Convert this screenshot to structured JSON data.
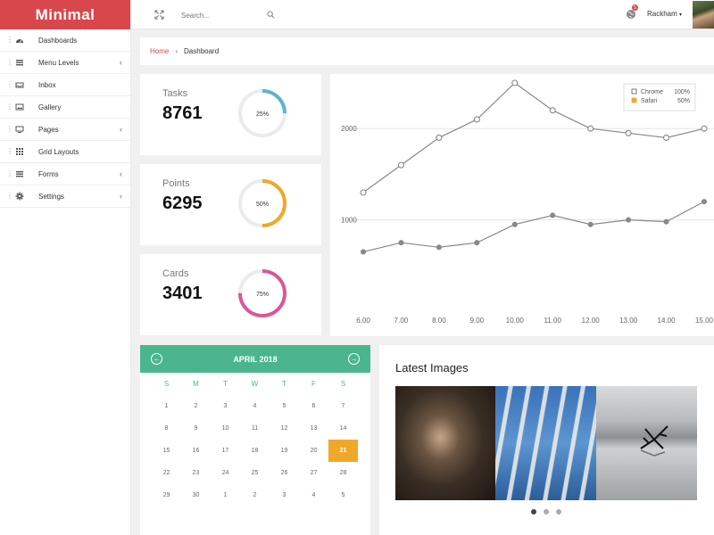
{
  "brand": "Minimal",
  "sidebar": {
    "items": [
      {
        "label": "Dashboards",
        "icon": "dashboard-icon",
        "has_children": false
      },
      {
        "label": "Menu Levels",
        "icon": "list-icon",
        "has_children": true
      },
      {
        "label": "Inbox",
        "icon": "inbox-icon",
        "has_children": false
      },
      {
        "label": "Gallery",
        "icon": "image-icon",
        "has_children": false
      },
      {
        "label": "Pages",
        "icon": "monitor-icon",
        "has_children": true
      },
      {
        "label": "Grid Layouts",
        "icon": "grid-icon",
        "has_children": false
      },
      {
        "label": "Forms",
        "icon": "form-icon",
        "has_children": true
      },
      {
        "label": "Settings",
        "icon": "gear-icon",
        "has_children": true
      }
    ],
    "chevron": "‹"
  },
  "topbar": {
    "search_placeholder": "Search...",
    "notification_count": "5",
    "username": "Rackham",
    "user_caret": "▾"
  },
  "breadcrumb": {
    "home": "Home",
    "separator": "›",
    "current": "Dashboard"
  },
  "stats": [
    {
      "label": "Tasks",
      "value": "8761",
      "percent": 25,
      "percent_label": "25%",
      "color": "#5bb5cf"
    },
    {
      "label": "Points",
      "value": "6295",
      "percent": 50,
      "percent_label": "50%",
      "color": "#f0a82a"
    },
    {
      "label": "Cards",
      "value": "3401",
      "percent": 75,
      "percent_label": "75%",
      "color": "#d95895"
    }
  ],
  "chart_data": {
    "type": "line",
    "x": [
      6.0,
      7.0,
      8.0,
      9.0,
      10.0,
      11.0,
      12.0,
      13.0,
      14.0,
      15.0
    ],
    "x_tick_labels": [
      "6.00",
      "7.00",
      "8.00",
      "9.00",
      "10.00",
      "11.00",
      "12.00",
      "13.00",
      "14.00",
      "15.00"
    ],
    "y_ticks": [
      1000,
      2000
    ],
    "y_tick_labels": [
      "1000",
      "2000"
    ],
    "ylim": [
      0,
      2500
    ],
    "series": [
      {
        "name": "Chrome",
        "legend_value": "100%",
        "marker": "hollow",
        "values": [
          1300,
          1600,
          1900,
          2100,
          2500,
          2200,
          2000,
          1950,
          1900,
          2000
        ]
      },
      {
        "name": "Safari",
        "legend_value": "50%",
        "marker": "filled",
        "values": [
          650,
          750,
          700,
          750,
          950,
          1050,
          950,
          1000,
          980,
          1200
        ]
      }
    ],
    "legend": {
      "position": "top-right",
      "colors": [
        "#ffffff",
        "#f0a82a"
      ]
    },
    "line_color": "#888888",
    "grid": true
  },
  "calendar": {
    "title": "APRIL 2018",
    "prev": "←",
    "next": "→",
    "weekdays": [
      "S",
      "M",
      "T",
      "W",
      "T",
      "F",
      "S"
    ],
    "weeks": [
      [
        "1",
        "2",
        "3",
        "4",
        "5",
        "6",
        "7"
      ],
      [
        "8",
        "9",
        "10",
        "11",
        "12",
        "13",
        "14"
      ],
      [
        "15",
        "16",
        "17",
        "18",
        "19",
        "20",
        "21"
      ],
      [
        "22",
        "23",
        "24",
        "25",
        "26",
        "27",
        "28"
      ],
      [
        "29",
        "30",
        "1",
        "2",
        "3",
        "4",
        "5"
      ]
    ],
    "today": "21",
    "header_color": "#4bb68e",
    "today_color": "#f0a82a"
  },
  "latest_images": {
    "title": "Latest Images",
    "slides": [
      "person-in-hoodie-image",
      "birch-trees-sky-image",
      "driftwood-lake-image"
    ],
    "active_slide": 0
  }
}
